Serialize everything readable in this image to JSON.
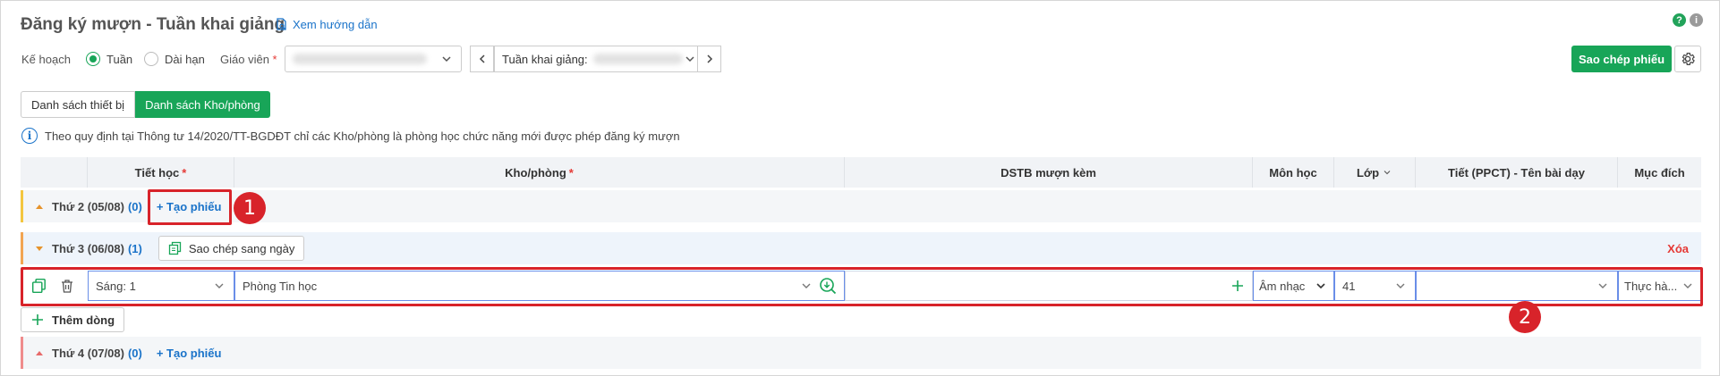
{
  "header": {
    "title": "Đăng ký mượn - Tuần khai giảng",
    "help_link": "Xem hướng dẫn"
  },
  "filters": {
    "plan_label": "Kế hoạch",
    "plan_options": [
      {
        "label": "Tuần",
        "selected": true
      },
      {
        "label": "Dài hạn",
        "selected": false
      }
    ],
    "teacher_label": "Giáo viên",
    "teacher_required": "*",
    "week_label": "Tuần khai giảng:"
  },
  "toolbar": {
    "copy_ticket_button": "Sao chép phiếu"
  },
  "tabs": [
    {
      "label": "Danh sách thiết bị",
      "active": false
    },
    {
      "label": "Danh sách Kho/phòng",
      "active": true
    }
  ],
  "notice": "Theo quy định tại Thông tư 14/2020/TT-BGDĐT chỉ các Kho/phòng là phòng học chức năng mới được phép đăng ký mượn",
  "table": {
    "columns": [
      {
        "label": "",
        "required": ""
      },
      {
        "label": "Tiết học",
        "required": "*"
      },
      {
        "label": "Kho/phòng",
        "required": "*"
      },
      {
        "label": "DSTB mượn kèm",
        "required": ""
      },
      {
        "label": "Môn học",
        "required": ""
      },
      {
        "label": "Lớp",
        "required": ""
      },
      {
        "label": "Tiết (PPCT) - Tên bài dạy",
        "required": ""
      },
      {
        "label": "Mục đích",
        "required": ""
      }
    ],
    "days": [
      {
        "label": "Thứ 2 (05/08)",
        "count": "(0)",
        "action": "+ Tạo phiếu"
      },
      {
        "label": "Thứ 3 (06/08)",
        "count": "(1)",
        "action": "Sao chép sang ngày",
        "delete": "Xóa"
      },
      {
        "label": "Thứ 4 (07/08)",
        "count": "(0)",
        "action": "+ Tạo phiếu"
      }
    ],
    "edit_row": {
      "period": "Sáng: 1",
      "room": "Phòng Tin học",
      "equipment": "",
      "subject": "Âm nhạc",
      "class": "41",
      "lesson": "",
      "purpose": "Thực hà..."
    },
    "add_row": "Thêm dòng"
  },
  "annotations": {
    "badge_1": "1",
    "badge_2": "2"
  },
  "colors": {
    "accent_green": "#18a558",
    "link_blue": "#1a73c9",
    "highlight_red": "#d8232a",
    "day_bar_mon": "#f3c63f",
    "day_bar_tue": "#f2a552",
    "day_bar_wed": "#ef8c8c"
  }
}
